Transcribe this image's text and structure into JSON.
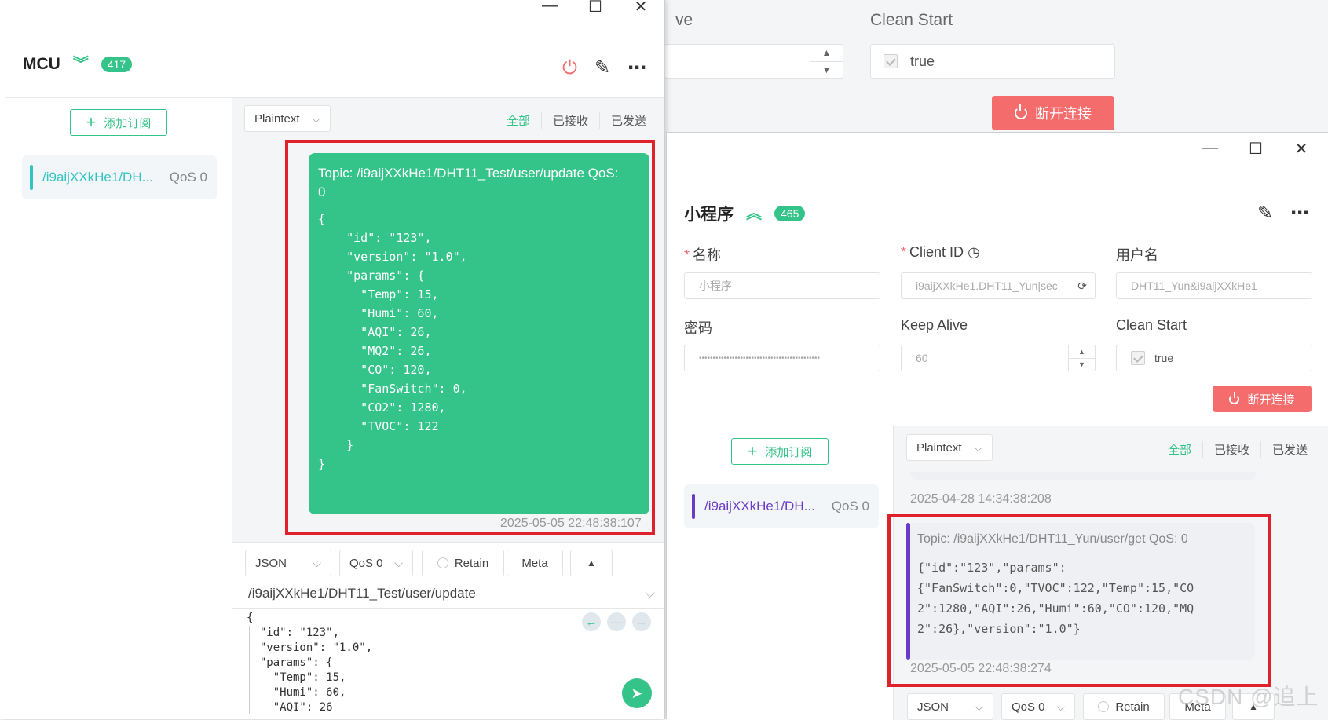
{
  "background_window": {
    "partial_label": "ve",
    "clean_start_label": "Clean Start",
    "clean_start_value": "true",
    "disconnect_label": "断开连接"
  },
  "mcu": {
    "window_controls": {
      "minimize": "—",
      "maximize": "☐",
      "close": "✕"
    },
    "connection_name": "MCU",
    "message_count": "417",
    "add_subscription_label": "添加订阅",
    "subscription": {
      "topic": "/i9aijXXkHe1/DH...",
      "qos": "QoS 0",
      "color": "#34c3c3"
    },
    "payload_format": "Plaintext",
    "filters": [
      "全部",
      "已接收",
      "已发送"
    ],
    "message": {
      "topic_line": "Topic: /i9aijXXkHe1/DHT11_Test/user/update     QoS:",
      "qos_value": "0",
      "payload": "{\n    \"id\": \"123\",\n    \"version\": \"1.0\",\n    \"params\": {\n      \"Temp\": 15,\n      \"Humi\": 60,\n      \"AQI\": 26,\n      \"MQ2\": 26,\n      \"CO\": 120,\n      \"FanSwitch\": 0,\n      \"CO2\": 1280,\n      \"TVOC\": 122\n    }\n}",
      "timestamp": "2025-05-05 22:48:38:107"
    },
    "composer": {
      "format": "JSON",
      "qos": "QoS 0",
      "retain_label": "Retain",
      "meta_label": "Meta",
      "topic": "/i9aijXXkHe1/DHT11_Test/user/update",
      "editor_lines": [
        "{",
        "  \"id\": \"123\",",
        "  \"version\": \"1.0\",",
        "  \"params\": {",
        "    \"Temp\": 15,",
        "    \"Humi\": 60,",
        "    \"AQI\": 26"
      ]
    }
  },
  "mini": {
    "window_controls": {
      "minimize": "—",
      "maximize": "☐",
      "close": "✕"
    },
    "connection_name": "小程序",
    "message_count": "465",
    "form": {
      "name_label": "名称",
      "name_value": "小程序",
      "client_id_label": "Client ID",
      "client_id_value": "i9aijXXkHe1.DHT11_Yun|sec",
      "username_label": "用户名",
      "username_value": "DHT11_Yun&i9aijXXkHe1",
      "password_label": "密码",
      "password_value": "••••••••••••••••••••••••••••••••••••••••••••",
      "keepalive_label": "Keep Alive",
      "keepalive_value": "60",
      "clean_start_label": "Clean Start",
      "clean_start_value": "true",
      "disconnect_label": "断开连接"
    },
    "add_subscription_label": "添加订阅",
    "subscription": {
      "topic": "/i9aijXXkHe1/DH...",
      "qos": "QoS 0",
      "color": "#6c3bc6"
    },
    "payload_format": "Plaintext",
    "filters": [
      "全部",
      "已接收",
      "已发送"
    ],
    "prev_timestamp": "2025-04-28 14:34:38:208",
    "message": {
      "topic_line": "Topic: /i9aijXXkHe1/DHT11_Yun/user/get     QoS: 0",
      "payload": "{\"id\":\"123\",\"params\":\n{\"FanSwitch\":0,\"TVOC\":122,\"Temp\":15,\"CO\n2\":1280,\"AQI\":26,\"Humi\":60,\"CO\":120,\"MQ\n2\":26},\"version\":\"1.0\"}",
      "timestamp": "2025-05-05 22:48:38:274"
    },
    "composer": {
      "format": "JSON",
      "qos": "QoS 0",
      "retain_label": "Retain",
      "meta_label": "Meta"
    }
  },
  "watermark": "CSDN @追上",
  "colors": {
    "accent": "#34c388",
    "danger": "#f56c6c",
    "highlight": "#e0202a"
  }
}
